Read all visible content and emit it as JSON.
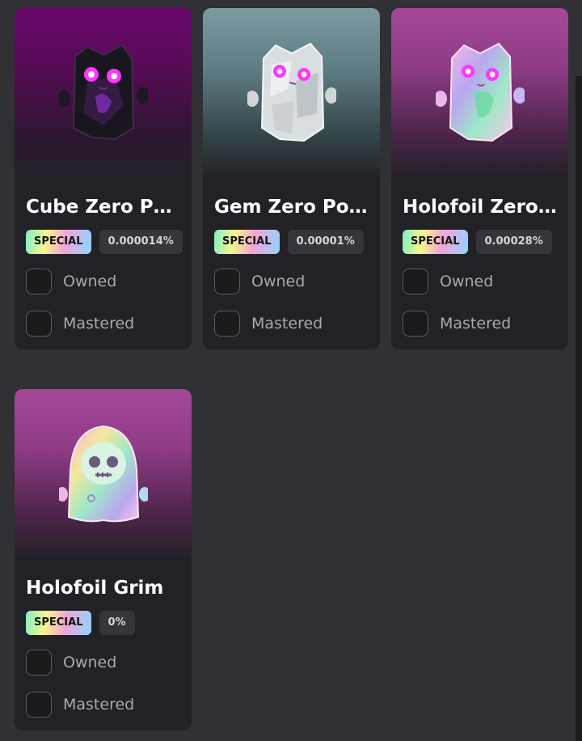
{
  "cards": [
    {
      "title": "Cube Zero Po...",
      "badge": "SPECIAL",
      "percent": "0.000014%",
      "owned_label": "Owned",
      "mastered_label": "Mastered",
      "image_icon": "dark-cube-creature-icon"
    },
    {
      "title": "Gem Zero Point",
      "badge": "SPECIAL",
      "percent": "0.00001%",
      "owned_label": "Owned",
      "mastered_label": "Mastered",
      "image_icon": "silver-gem-creature-icon"
    },
    {
      "title": "Holofoil Zero ...",
      "badge": "SPECIAL",
      "percent": "0.00028%",
      "owned_label": "Owned",
      "mastered_label": "Mastered",
      "image_icon": "holofoil-creature-icon"
    },
    {
      "title": "Holofoil Grim",
      "badge": "SPECIAL",
      "percent": "0%",
      "owned_label": "Owned",
      "mastered_label": "Mastered",
      "image_icon": "holofoil-grim-creature-icon"
    }
  ],
  "colors": {
    "background": "#303035",
    "card": "#222226",
    "accent_magenta": "#ff3cff"
  }
}
